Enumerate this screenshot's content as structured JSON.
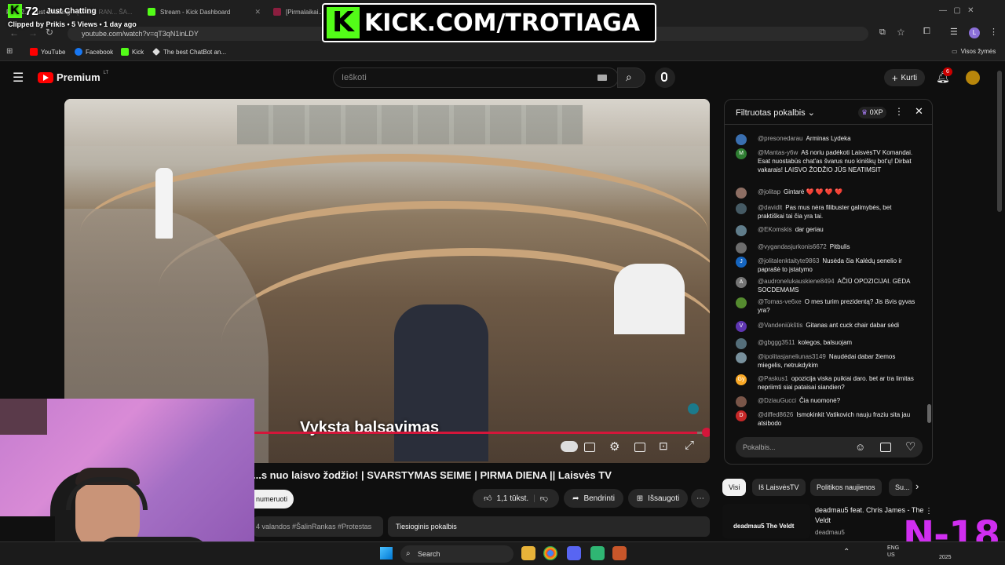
{
  "browser": {
    "tabs": [
      {
        "label": "Pe... 2... ...ust Chatting"
      },
      {
        "label": "[ŠALIN RAN... ŠA..."
      },
      {
        "label": "Stream - Kick Dashboard"
      },
      {
        "label": "[Pirmalaikai..."
      }
    ],
    "url": "youtube.com/watch?v=qT3qN1inLDY",
    "bookmarks": [
      {
        "label": "YouTube",
        "color": "#ff0000"
      },
      {
        "label": "Facebook",
        "color": "#1877f2"
      },
      {
        "label": "Kick",
        "color": "#53fc18"
      },
      {
        "label": "The best ChatBot an...",
        "color": "#dddddd"
      }
    ],
    "bookmarks_right": "Visos žymės",
    "profile_initial": "L"
  },
  "overlay": {
    "kick_banner": "KICK.COM/TROTIAGA",
    "kick_letter": "K",
    "viewer_count": "72",
    "category": "Just Chatting",
    "clip_line": "Clipped by Prikis • 5 Views • 1 day ago",
    "rating": "N-18"
  },
  "youtube": {
    "brand": "Premium",
    "brand_region": "LT",
    "search_placeholder": "Ieškoti",
    "create_label": "Kurti",
    "notifications": "6"
  },
  "video": {
    "subtitle": "Vyksta balsavimas",
    "progress_fraction": 0.98,
    "title": "...s nuo laisvo žodžio! | SVARSTYMAS SEIME | PIRMA DIENA || Laisvės TV",
    "subscribe_label": "numeruoti",
    "likes": "1,1 tūkst.",
    "share_label": "Bendrinti",
    "save_label": "Išsaugoti",
    "desc_snippet": "4 valandos #ŠalinRankas #Protestas",
    "live_chat_label": "Tiesioginis pokalbis"
  },
  "chat": {
    "header": "Filtruotas pokalbis",
    "xp": "0XP",
    "input_placeholder": "Pokalbis...",
    "messages": [
      {
        "author": "@presonedarau",
        "text": "Arminas Lydeka",
        "avatar": "",
        "color": "#3a6fb0"
      },
      {
        "author": "@Mantas-y6w",
        "text": "Aš noriu padėkoti LaisvėsTV Komandai. Esat nuostabūs chat'as švarus nuo kiniškų bot'ų! Dirbat vakarais! LAISVO ŽODŽIO JŪS NEATIMSIT",
        "avatar": "M",
        "color": "#2e7d32"
      },
      {
        "author": "@jolitap",
        "text": "Gintarė ❤️ ❤️ ❤️ ❤️",
        "avatar": "",
        "color": "#8d6e63"
      },
      {
        "author": "@davidlt",
        "text": "Pas mus nėra filibuster galimybės, bet praktiškai tai čia yra tai.",
        "avatar": "",
        "color": "#455a64"
      },
      {
        "author": "@EKomskis",
        "text": "dar geriau",
        "avatar": "",
        "color": "#607d8b"
      },
      {
        "author": "@vygandasjurkonis6672",
        "text": "Pitbulis",
        "avatar": "",
        "color": "#6d6d6d"
      },
      {
        "author": "@jolitalenktaityte9863",
        "text": "Nusėda čia Kalėdų senelio ir paprašė to įstatymo",
        "avatar": "J",
        "color": "#1565c0"
      },
      {
        "author": "@audronelukauskiene8494",
        "text": "AČIŪ OPOZICIJAI. GĖDA SOCDEMAMS",
        "avatar": "A",
        "color": "#757575"
      },
      {
        "author": "@Tomas-ve6xe",
        "text": "O mes turim prezidentą? Jis išvis gyvas yra?",
        "avatar": "",
        "color": "#558b2f"
      },
      {
        "author": "@Vandeniūkštis",
        "text": "Gitanas ant cuck chair dabar sėdi",
        "avatar": "V",
        "color": "#5e35b1"
      },
      {
        "author": "@gbggg3511",
        "text": "kolegos, balsuojam",
        "avatar": "",
        "color": "#546e7a"
      },
      {
        "author": "@ipolitasjaneliunas3149",
        "text": "Naudėdai dabar žiemos miegelis, netrukdykim",
        "avatar": "",
        "color": "#78909c"
      },
      {
        "author": "@Paskus1",
        "text": "opozicija viska puikiai daro. bet ar tra limitas nepriimti siai pataisai siandien?",
        "avatar": "Gy",
        "color": "#f9a825"
      },
      {
        "author": "@DziauGucci",
        "text": "Čia nuomonė?",
        "avatar": "",
        "color": "#795548"
      },
      {
        "author": "@diffed8626",
        "text": "Ismokinkit Vatikovich nauju fraziu sita jau atsibodo",
        "avatar": "D",
        "color": "#c62828"
      }
    ]
  },
  "recommendations": {
    "chips": [
      "Visi",
      "Iš LaisvėsTV",
      "Politikos naujienos",
      "Su..."
    ],
    "item_title": "deadmau5 feat. Chris James - The Veldt",
    "item_channel": "deadmau5",
    "thumb_text": "deadmau5 The Veldt"
  },
  "taskbar": {
    "search_label": "Search",
    "lang_top": "ENG",
    "lang_bottom": "US",
    "year_fragment": "2025"
  }
}
